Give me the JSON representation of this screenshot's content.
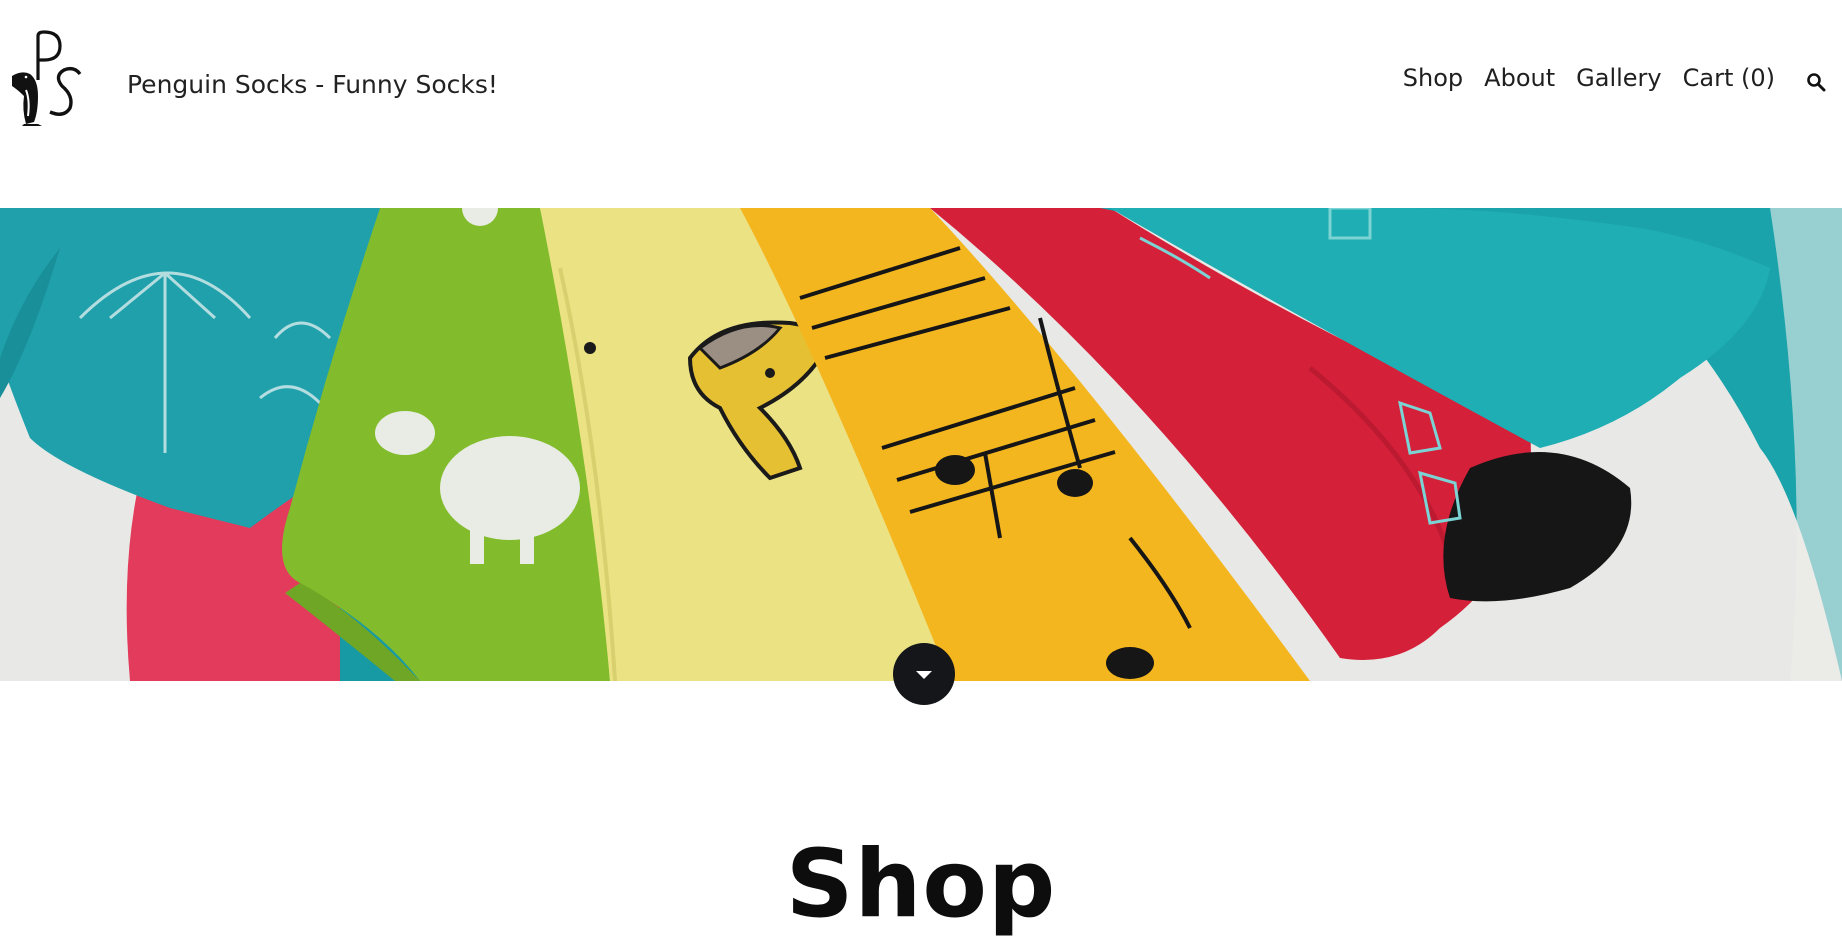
{
  "header": {
    "logo_alt": "PS",
    "site_title": "Penguin Socks - Funny Socks!"
  },
  "nav": {
    "items": [
      {
        "label": "Shop"
      },
      {
        "label": "About"
      },
      {
        "label": "Gallery"
      },
      {
        "label": "Cart (0)"
      }
    ],
    "search_icon": "search-icon"
  },
  "hero": {
    "image": "colorful-socks-banner",
    "colors": {
      "teal": "#1fa6b0",
      "green": "#86c02b",
      "pale_yellow": "#e9e07a",
      "yellow": "#f5b51c",
      "red": "#d5203a",
      "pink": "#e23a5a",
      "black": "#161616"
    }
  },
  "scroll_button_icon": "caret-down-icon",
  "main": {
    "heading": "Shop"
  }
}
